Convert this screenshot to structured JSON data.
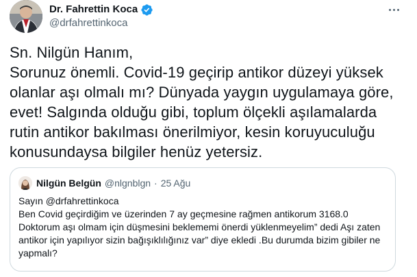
{
  "tweet": {
    "author_name": "Dr. Fahrettin Koca",
    "author_handle": "@drfahrettinkoca",
    "verified_icon": "verified-badge-icon",
    "more_icon": "more-options-icon",
    "text": "Sn. Nilgün Hanım,\nSorunuz önemli. Covid-19 geçirip antikor düzeyi yüksek olanlar aşı olmalı mı? Dünyada yaygın uygulamaya göre, evet! Salgında olduğu gibi, toplum ölçekli aşılamalarda rutin antikor bakılması önerilmiyor, kesin koruyuculuğu konusundaysa bilgiler henüz yetersiz."
  },
  "quoted_tweet": {
    "author_name": "Nilgün Belgün",
    "author_handle": "@nlgnblgn",
    "separator": "·",
    "date": "25 Ağu",
    "text": "Sayın @drfahrettinkoca\nBen Covid geçirdiğim ve üzerinden 7 ay geçmesine rağmen antikorum 3168.0 Doktorum aşı olmam için düşmesini beklememi önerdi yüklenmeyelim” dedi Aşı zaten antikor için yapılıyor sizin bağışıklılığınız var” diye ekledi .Bu durumda bizim gibiler ne yapmalı?"
  },
  "colors": {
    "text_primary": "#0f1419",
    "text_secondary": "#536471",
    "verified_blue": "#1d9bf0",
    "border": "#cfd9de"
  }
}
